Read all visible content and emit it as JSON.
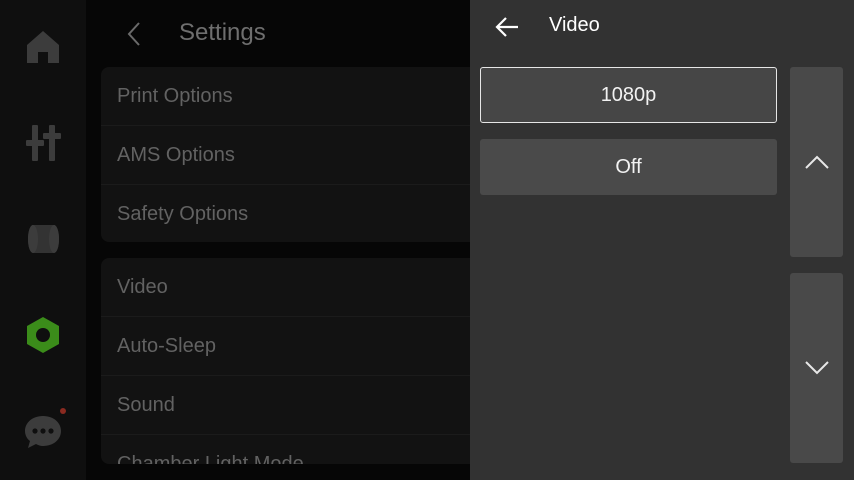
{
  "nav": {
    "items": [
      {
        "icon": "home-icon"
      },
      {
        "icon": "controls-icon"
      },
      {
        "icon": "filament-icon"
      },
      {
        "icon": "settings-icon",
        "active": true
      },
      {
        "icon": "messages-icon",
        "has_notification": true
      }
    ],
    "accent_color": "#3b8c1a"
  },
  "settings": {
    "title": "Settings",
    "group1": [
      "Print Options",
      "AMS Options",
      "Safety Options"
    ],
    "group2": [
      "Video",
      "Auto-Sleep",
      "Sound",
      "Chamber Light Mode"
    ]
  },
  "video_panel": {
    "title": "Video",
    "options": [
      {
        "label": "1080p",
        "selected": true
      },
      {
        "label": "Off",
        "selected": false
      }
    ]
  }
}
